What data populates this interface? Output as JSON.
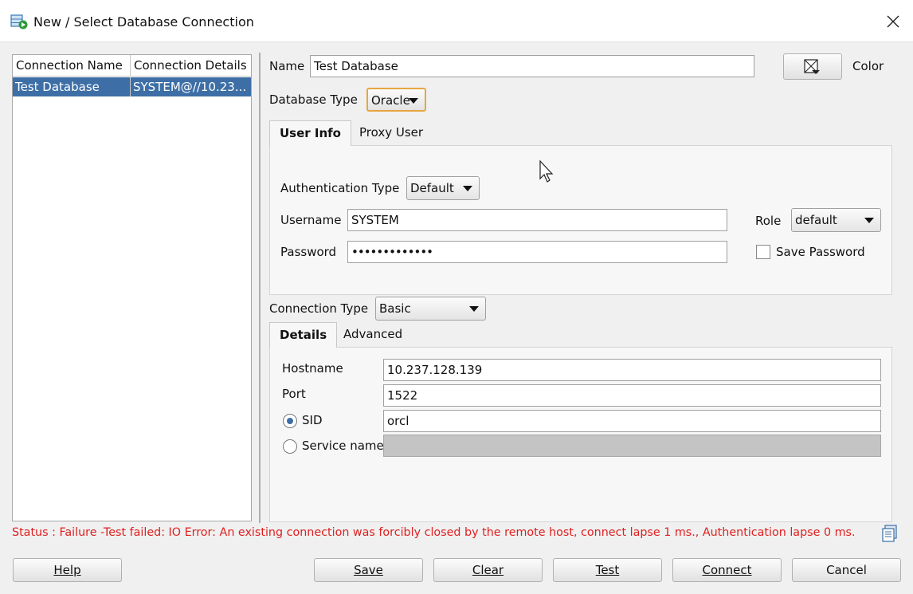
{
  "window": {
    "title": "New / Select Database Connection"
  },
  "connections": {
    "headers": [
      "Connection Name",
      "Connection Details"
    ],
    "rows": [
      {
        "name": "Test Database",
        "details": "SYSTEM@//10.23..."
      }
    ]
  },
  "form": {
    "name_label": "Name",
    "name_value": "Test Database",
    "color_label": "Color",
    "db_type_label": "Database Type",
    "db_type_value": "Oracle",
    "user_tabs": [
      "User Info",
      "Proxy User"
    ],
    "auth_type_label": "Authentication Type",
    "auth_type_value": "Default",
    "username_label": "Username",
    "username_value": "SYSTEM",
    "password_label": "Password",
    "password_value": "•••••••••••••",
    "role_label": "Role",
    "role_value": "default",
    "save_password_label": "Save Password",
    "save_password_checked": false,
    "conn_type_label": "Connection Type",
    "conn_type_value": "Basic",
    "detail_tabs": [
      "Details",
      "Advanced"
    ],
    "hostname_label": "Hostname",
    "hostname_value": "10.237.128.139",
    "port_label": "Port",
    "port_value": "1522",
    "sid_label": "SID",
    "sid_value": "orcl",
    "sid_selected": true,
    "service_label": "Service name",
    "service_value": ""
  },
  "status": "Status : Failure -Test failed: IO Error: An existing connection was forcibly closed by the remote host, connect lapse 1 ms., Authentication lapse 0 ms.",
  "buttons": {
    "help": "Help",
    "save": "Save",
    "clear": "Clear",
    "test": "Test",
    "connect": "Connect",
    "cancel": "Cancel"
  },
  "colors": {
    "status": "#e02020",
    "selection": "#3d6fa6",
    "focus": "#e7a640"
  }
}
